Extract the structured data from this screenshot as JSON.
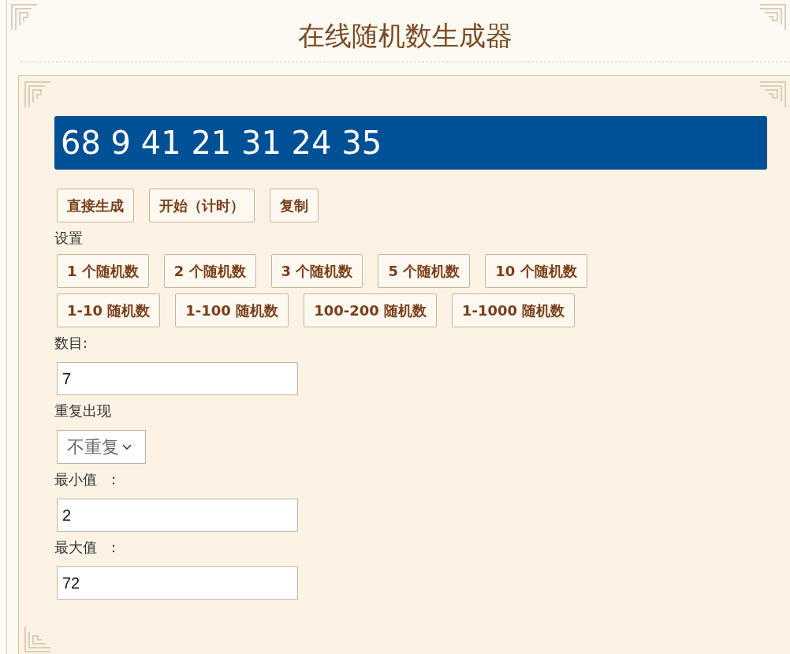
{
  "title": "在线随机数生成器",
  "result": "68 9 41 21 31 24 35",
  "actions": [
    "直接生成",
    "开始（计时）",
    "复制"
  ],
  "settings_label": "设置",
  "preset_rows": [
    [
      "1 个随机数",
      "2 个随机数",
      "3 个随机数",
      "5 个随机数",
      "10 个随机数"
    ],
    [
      "1-10 随机数",
      "1-100 随机数",
      "100-200 随机数",
      "1-1000 随机数"
    ]
  ],
  "fields": [
    {
      "kind": "input",
      "label": "数目:",
      "value": "7"
    },
    {
      "kind": "select",
      "label": "重复出现",
      "value": "不重复"
    },
    {
      "kind": "input",
      "label": "最小值　:",
      "value": "2"
    },
    {
      "kind": "input",
      "label": "最大值　:",
      "value": "72"
    }
  ]
}
